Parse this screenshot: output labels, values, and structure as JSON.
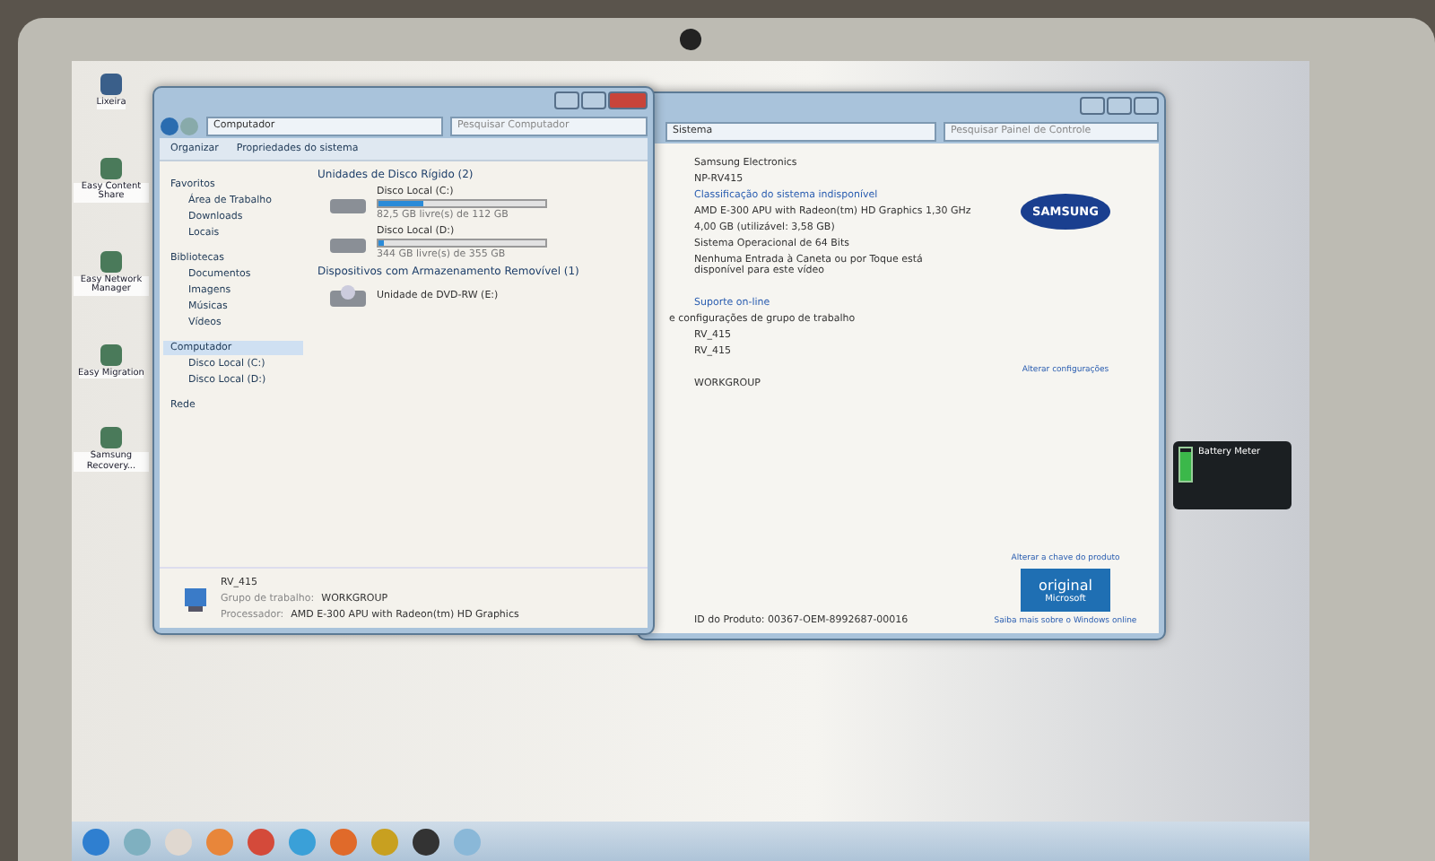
{
  "desktop_icons": [
    {
      "label": "Lixeira"
    },
    {
      "label": "Easy Content Share"
    },
    {
      "label": "Easy Network Manager"
    },
    {
      "label": "Easy Migration"
    },
    {
      "label": "Samsung Recovery..."
    }
  ],
  "explorer": {
    "address": "Computador",
    "search_placeholder": "Pesquisar Computador",
    "toolbar": [
      "Organizar",
      "Propriedades do sistema"
    ],
    "nav": [
      {
        "label": "Favoritos",
        "selected": false,
        "children": [
          {
            "label": "Área de Trabalho",
            "selected": false
          },
          {
            "label": "Downloads",
            "selected": false
          },
          {
            "label": "Locais",
            "selected": false
          }
        ]
      },
      {
        "label": "Bibliotecas",
        "selected": false,
        "children": [
          {
            "label": "Documentos",
            "selected": false
          },
          {
            "label": "Imagens",
            "selected": false
          },
          {
            "label": "Músicas",
            "selected": false
          },
          {
            "label": "Vídeos",
            "selected": false
          }
        ]
      },
      {
        "label": "Computador",
        "selected": true,
        "children": [
          {
            "label": "Disco Local (C:)",
            "selected": false
          },
          {
            "label": "Disco Local (D:)",
            "selected": false
          }
        ]
      },
      {
        "label": "Rede",
        "selected": false
      }
    ],
    "groups": [
      {
        "title": "Unidades de Disco Rígido (2)",
        "items": [
          {
            "kind": "disk",
            "name": "Disco Local (C:)",
            "level": 0.27,
            "free": "82,5 GB livre(s) de 112 GB"
          },
          {
            "kind": "disk",
            "name": "Disco Local (D:)",
            "level": 0.03,
            "free": "344 GB livre(s) de 355 GB"
          }
        ]
      },
      {
        "title": "Dispositivos com Armazenamento Removível (1)",
        "items": [
          {
            "kind": "dvd",
            "name": "Unidade de DVD-RW (E:)"
          }
        ]
      }
    ],
    "details": {
      "name": "RV_415",
      "rows": [
        {
          "label": "Grupo de trabalho:",
          "value": "WORKGROUP"
        },
        {
          "label": "Processador:",
          "value": "AMD E-300 APU with Radeon(tm) HD Graphics"
        }
      ]
    }
  },
  "system": {
    "address": "Sistema",
    "search_placeholder": "Pesquisar Painel de Controle",
    "logo": "SAMSUNG",
    "lines": [
      {
        "kind": "text",
        "text": "Samsung Electronics"
      },
      {
        "kind": "text",
        "text": "NP-RV415"
      },
      {
        "kind": "link",
        "text": "Classificação do sistema indisponível"
      },
      {
        "kind": "text",
        "text": "AMD E-300 APU with Radeon(tm) HD Graphics 1,30 GHz"
      },
      {
        "kind": "text",
        "text": "4,00 GB (utilizável: 3,58 GB)"
      },
      {
        "kind": "text",
        "text": "Sistema Operacional de 64 Bits"
      },
      {
        "kind": "text",
        "text": "Nenhuma Entrada à Caneta ou por Toque está disponível para este vídeo"
      },
      {
        "kind": "gap"
      },
      {
        "kind": "link",
        "text": "Suporte on-line"
      },
      {
        "kind": "heading",
        "text": "e configurações de grupo de trabalho"
      },
      {
        "kind": "text",
        "text": "RV_415"
      },
      {
        "kind": "text",
        "text": "RV_415"
      },
      {
        "kind": "gap"
      },
      {
        "kind": "text",
        "text": "WORKGROUP"
      }
    ],
    "change_link": "Alterar configurações",
    "product_id": "ID do Produto: 00367-OEM-8992687-00016",
    "key_link": "Alterar a chave do produto",
    "badge": [
      "original",
      "Microsoft"
    ],
    "more_link": "Saiba mais sobre o Windows online"
  },
  "gadget": {
    "title": "Battery Meter",
    "level": 0.9
  }
}
